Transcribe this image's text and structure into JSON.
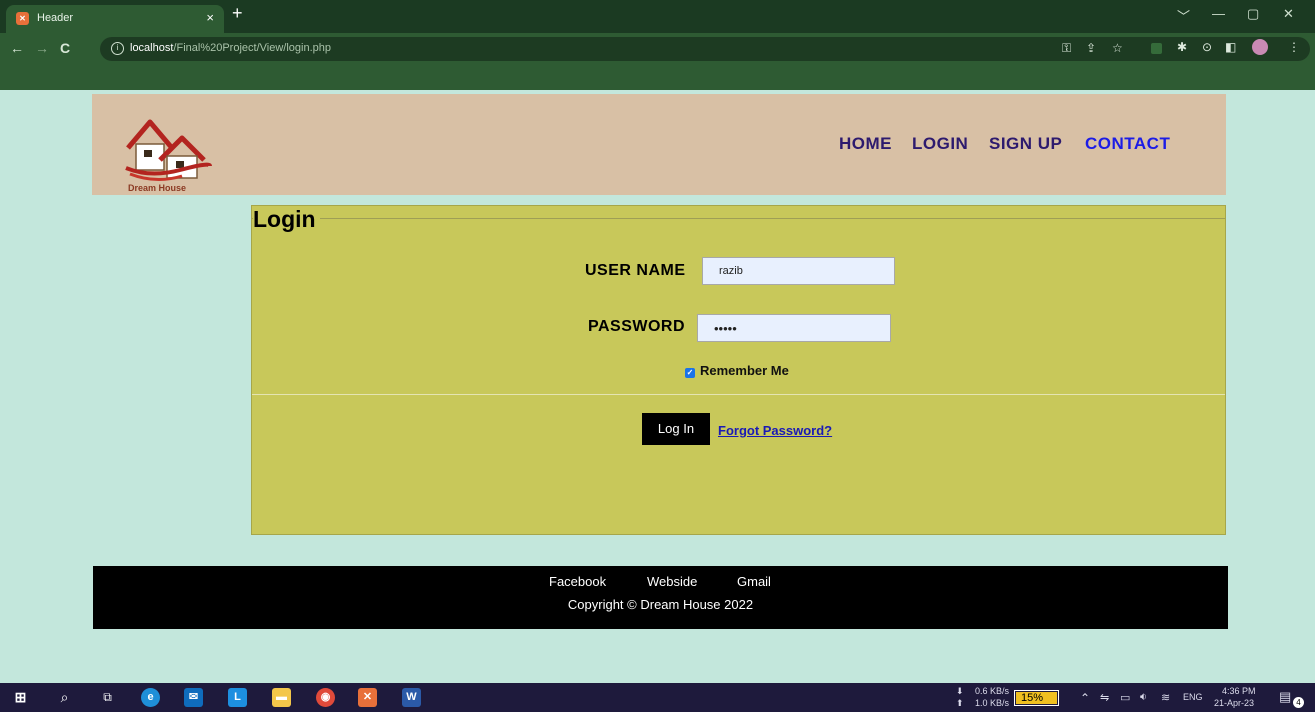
{
  "browser": {
    "tab_title": "Header",
    "tab_close": "×",
    "new_tab": "+",
    "url_host": "localhost",
    "url_path": "/Final%20Project/View/login.php",
    "window_controls": [
      "﹀",
      "—",
      "▢",
      "✕"
    ]
  },
  "site": {
    "logo_text": "Dream House",
    "nav": {
      "home": "HOME",
      "login": "LOGIN",
      "signup": "SIGN UP",
      "contact": "CONTACT"
    }
  },
  "login": {
    "legend": "Login",
    "username_label": "USER NAME",
    "username_value": "razib",
    "password_label": "PASSWORD",
    "password_value": "•••••",
    "remember_label": "Remember Me",
    "remember_checked": true,
    "login_button": "Log In",
    "forgot_link": "Forgot Password?"
  },
  "footer": {
    "links": [
      "Facebook",
      "Webside",
      "Gmail"
    ],
    "copyright": "Copyright © Dream House 2022"
  },
  "taskbar": {
    "net_down": "0.6 KB/s",
    "net_up": "1.0 KB/s",
    "battery": "15%",
    "language": "ENG",
    "time": "4:36 PM",
    "date": "21-Apr-23",
    "notifications": "4"
  },
  "colors": {
    "page_bg": "#c3e7dc",
    "header_bg": "#d8c0a5",
    "login_bg": "#c8c85a",
    "nav_text": "#2d1a6e",
    "contact_text": "#1c1ce6",
    "chrome": "#2e5b33"
  }
}
